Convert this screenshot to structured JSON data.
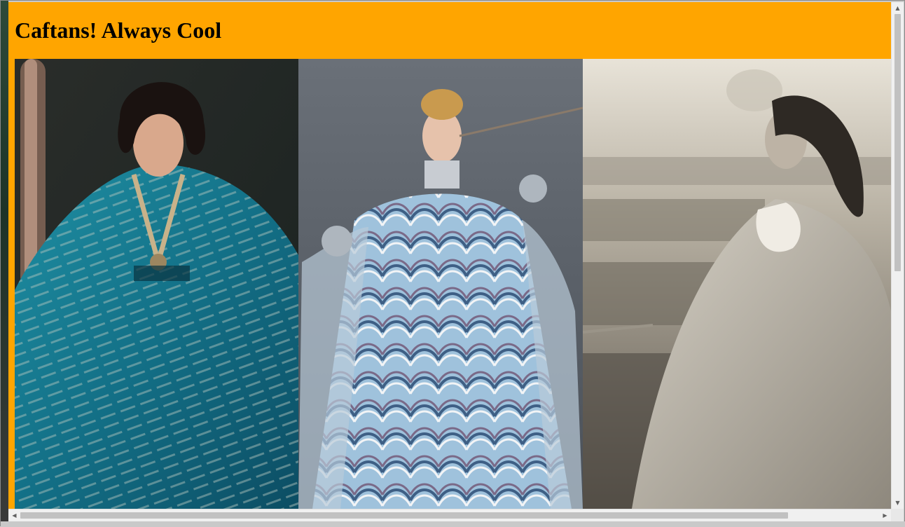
{
  "page": {
    "title": "Caftans! Always Cool",
    "header_color": "#ffa500"
  },
  "gallery": {
    "images": [
      {
        "name": "teal-caftan-photo",
        "palette": "teal"
      },
      {
        "name": "marbled-blue-caftan-photo",
        "palette": "blue-marble"
      },
      {
        "name": "sepia-caftan-photo",
        "palette": "sepia"
      }
    ]
  },
  "scrollbars": {
    "vertical": {
      "up_icon": "arrow-up-icon",
      "down_icon": "arrow-down-icon",
      "up_glyph": "▲",
      "down_glyph": "▼"
    },
    "horizontal": {
      "left_icon": "arrow-left-icon",
      "right_icon": "arrow-right-icon",
      "left_glyph": "◀",
      "right_glyph": "▶"
    }
  }
}
